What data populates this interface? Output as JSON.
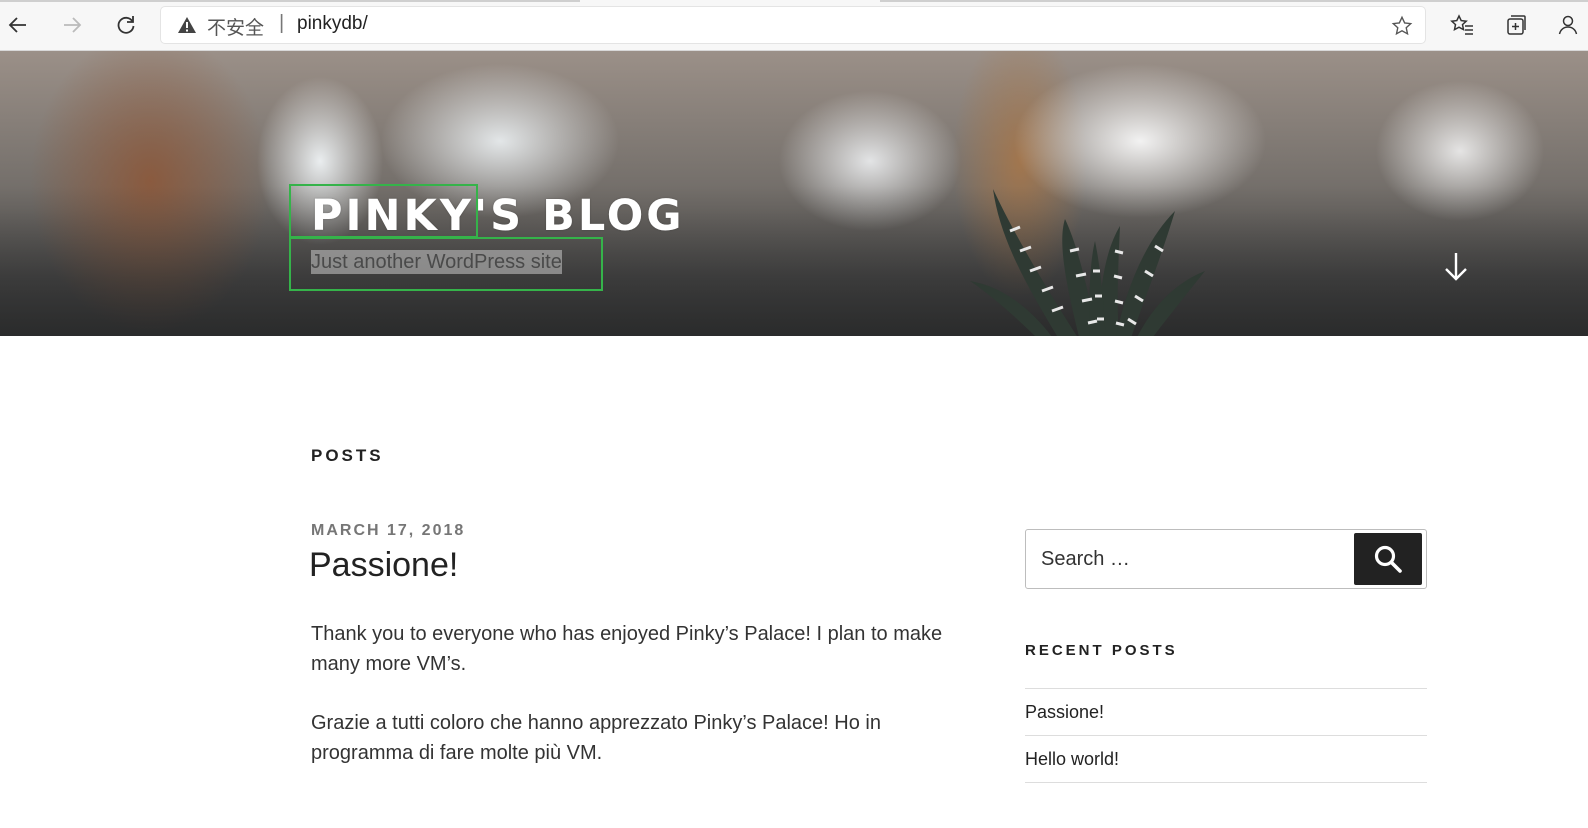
{
  "browser": {
    "security_label": "不安全",
    "separator": "|",
    "url": "pinkydb/"
  },
  "header": {
    "site_title": "PINKY'S BLOG",
    "site_description": "Just another WordPress site"
  },
  "main": {
    "page_label": "POSTS",
    "post": {
      "date": "MARCH 17, 2018",
      "title": "Passione!",
      "paragraphs": [
        "Thank you to everyone who has enjoyed Pinky’s Palace! I plan to make many more VM’s.",
        "Grazie a tutti coloro che hanno apprezzato Pinky’s Palace! Ho in programma di fare molte più VM."
      ]
    }
  },
  "sidebar": {
    "search": {
      "placeholder": "Search …"
    },
    "recent_posts_title": "RECENT POSTS",
    "recent_posts": [
      {
        "label": "Passione!"
      },
      {
        "label": "Hello world!"
      }
    ]
  },
  "colors": {
    "highlight_box": "#35b34a",
    "search_button": "#222222",
    "date_gray": "#767676"
  }
}
